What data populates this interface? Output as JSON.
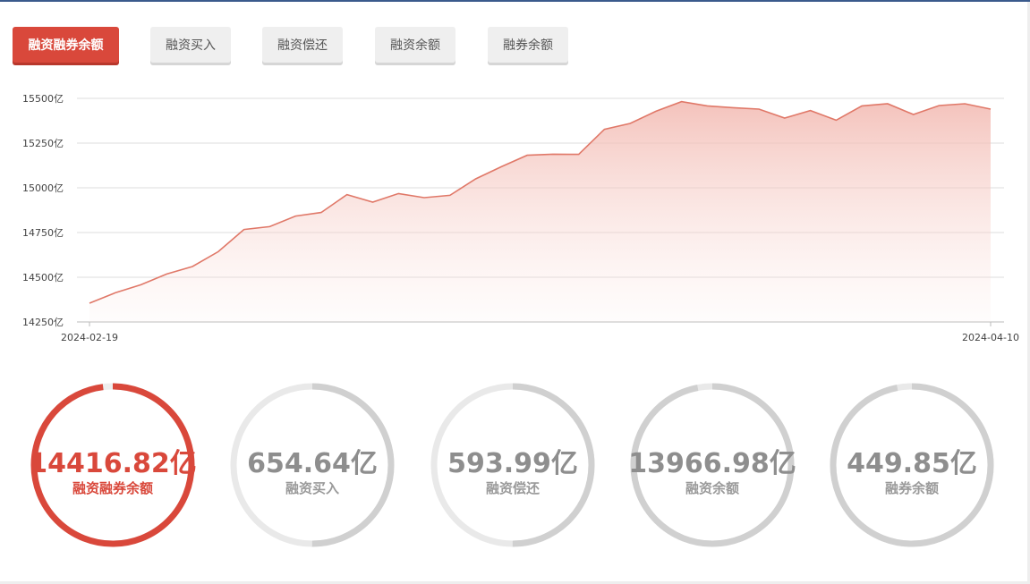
{
  "tabs": [
    {
      "label": "融资融券余额",
      "active": true
    },
    {
      "label": "融资买入",
      "active": false
    },
    {
      "label": "融资偿还",
      "active": false
    },
    {
      "label": "融资余额",
      "active": false
    },
    {
      "label": "融券余额",
      "active": false
    }
  ],
  "colors": {
    "accent": "#d9483b",
    "line": "#e07868",
    "inactive_text": "#9a9a9a"
  },
  "chart_data": {
    "type": "area",
    "y_tick_labels": [
      "15500亿",
      "15250亿",
      "15000亿",
      "14750亿",
      "14500亿",
      "14250亿"
    ],
    "y_ticks": [
      15500,
      15250,
      15000,
      14750,
      14500,
      14250
    ],
    "ylim": [
      14250,
      15500
    ],
    "x_tick_labels": [
      "2024-02-19",
      "2024-04-10"
    ],
    "grid": true,
    "series": [
      {
        "values": [
          14355,
          14413,
          14458,
          14518,
          14560,
          14643,
          14767,
          14783,
          14842,
          14862,
          14962,
          14920,
          14968,
          14945,
          14958,
          15050,
          15118,
          15182,
          15188,
          15187,
          15327,
          15360,
          15428,
          15482,
          15458,
          15448,
          15440,
          15390,
          15432,
          15378,
          15458,
          15470,
          15410,
          15460,
          15470,
          15440
        ]
      }
    ]
  },
  "stats": [
    {
      "value": "14416.82亿",
      "label": "融资融券余额",
      "fraction": 0.98,
      "active": true
    },
    {
      "value": "654.64亿",
      "label": "融资买入",
      "fraction": 0.5,
      "active": false
    },
    {
      "value": "593.99亿",
      "label": "融资偿还",
      "fraction": 0.5,
      "active": false
    },
    {
      "value": "13966.98亿",
      "label": "融资余额",
      "fraction": 0.97,
      "active": false
    },
    {
      "value": "449.85亿",
      "label": "融券余额",
      "fraction": 0.97,
      "active": false
    }
  ]
}
